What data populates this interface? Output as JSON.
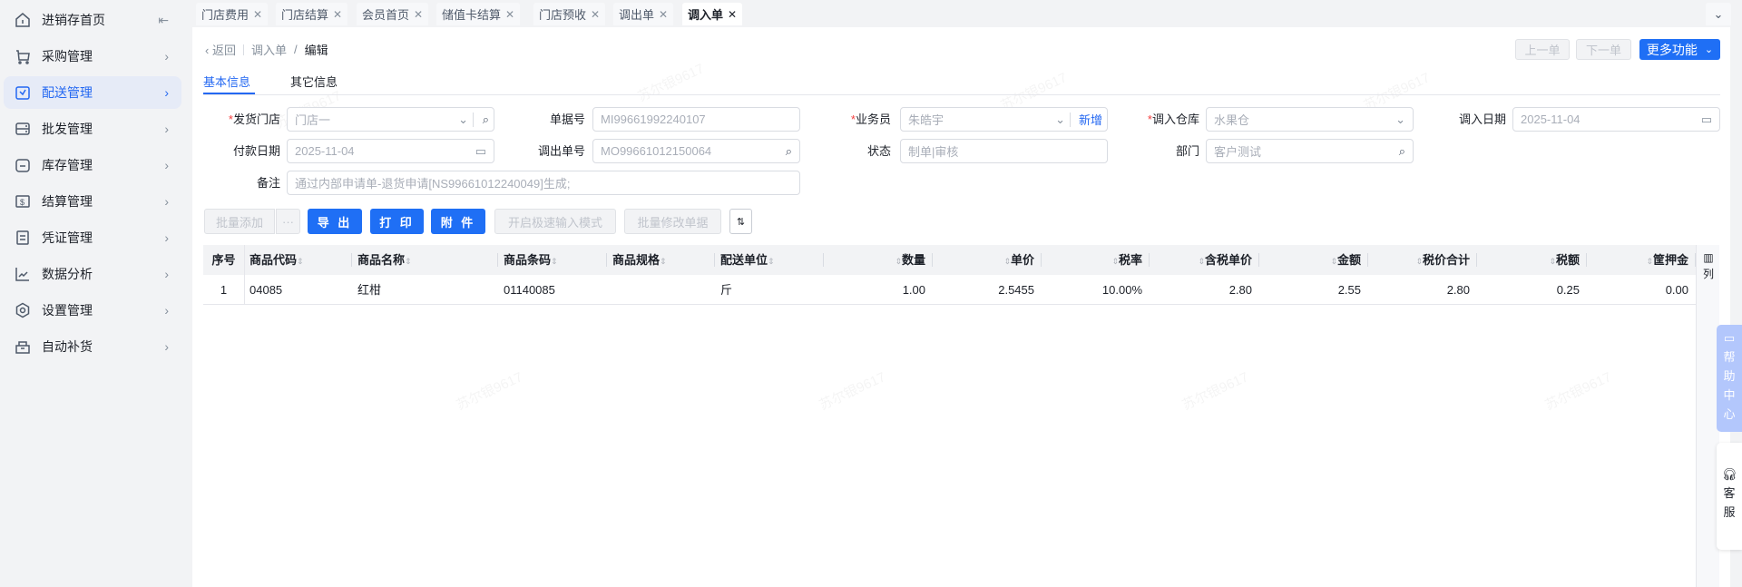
{
  "sidebar": {
    "items": [
      {
        "label": "进销存首页",
        "icon": "home-icon"
      },
      {
        "label": "采购管理",
        "icon": "cart-icon"
      },
      {
        "label": "配送管理",
        "icon": "map-icon",
        "active": true
      },
      {
        "label": "批发管理",
        "icon": "server-icon"
      },
      {
        "label": "库存管理",
        "icon": "inbox-icon"
      },
      {
        "label": "结算管理",
        "icon": "dollar-icon"
      },
      {
        "label": "凭证管理",
        "icon": "document-icon"
      },
      {
        "label": "数据分析",
        "icon": "chart-icon"
      },
      {
        "label": "设置管理",
        "icon": "settings-icon"
      },
      {
        "label": "自动补货",
        "icon": "replenish-icon"
      }
    ]
  },
  "tabs": [
    {
      "label": "门店费用"
    },
    {
      "label": "门店结算"
    },
    {
      "label": "会员首页"
    },
    {
      "label": "储值卡结算"
    },
    {
      "label": "门店预收"
    },
    {
      "label": "调出单"
    },
    {
      "label": "调入单",
      "active": true
    }
  ],
  "header": {
    "back": "返回",
    "breadcrumb_parent": "调入单",
    "breadcrumb_sep": "/",
    "breadcrumb_current": "编辑",
    "prev": "上一单",
    "next": "下一单",
    "more": "更多功能"
  },
  "subtabs": [
    "基本信息",
    "其它信息"
  ],
  "form": {
    "required_mark": "*",
    "ship_store": {
      "label": "发货门店",
      "value": "门店一"
    },
    "doc_no": {
      "label": "单据号",
      "value": "MI99661992240107"
    },
    "salesman": {
      "label": "业务员",
      "value": "朱皓宇",
      "add": "新增"
    },
    "in_warehouse": {
      "label": "调入仓库",
      "value": "水果仓"
    },
    "in_date": {
      "label": "调入日期",
      "value": "2025-11-04"
    },
    "pay_date": {
      "label": "付款日期",
      "value": "2025-11-04"
    },
    "out_no": {
      "label": "调出单号",
      "value": "MO99661012150064"
    },
    "status": {
      "label": "状态",
      "value": "制单|审核"
    },
    "dept": {
      "label": "部门",
      "value": "客户测试"
    },
    "remark": {
      "label": "备注",
      "value": "通过内部申请单-退货申请[NS99661012240049]生成;"
    }
  },
  "toolbar": {
    "batch_add": "批量添加",
    "more": "···",
    "export": "导 出",
    "print": "打 印",
    "attach": "附 件",
    "fast_input": "开启极速输入模式",
    "batch_edit": "批量修改单据"
  },
  "table": {
    "columns": [
      "序号",
      "商品代码",
      "商品名称",
      "商品条码",
      "商品规格",
      "配送单位",
      "数量",
      "单价",
      "税率",
      "含税单价",
      "金额",
      "税价合计",
      "税额",
      "筐押金"
    ],
    "column_setting": "列",
    "rows": [
      [
        "1",
        "04085",
        "红柑",
        "01140085",
        "",
        "斤",
        "1.00",
        "2.5455",
        "10.00%",
        "2.80",
        "2.55",
        "2.80",
        "0.25",
        "0.00"
      ]
    ]
  },
  "float": {
    "help": "帮助中心",
    "service": "客服"
  },
  "watermark": "苏尔银9617",
  "colors": {
    "primary": "#1f6ff5",
    "required": "#f53f3f"
  }
}
